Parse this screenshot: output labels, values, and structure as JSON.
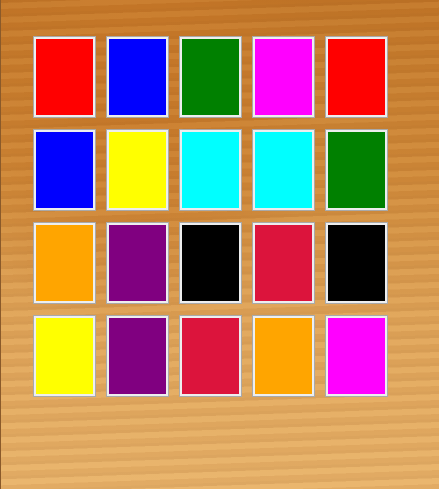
{
  "board": {
    "rows": [
      [
        "#ff0000",
        "#0000ff",
        "#008000",
        "#ff00ff",
        "#ff0000"
      ],
      [
        "#0000ff",
        "#ffff00",
        "#00ffff",
        "#00ffff",
        "#008000"
      ],
      [
        "#ffa500",
        "#800080",
        "#000000",
        "#dc143c",
        "#000000"
      ],
      [
        "#ffff00",
        "#800080",
        "#dc143c",
        "#ffa500",
        "#ff00ff"
      ]
    ]
  }
}
